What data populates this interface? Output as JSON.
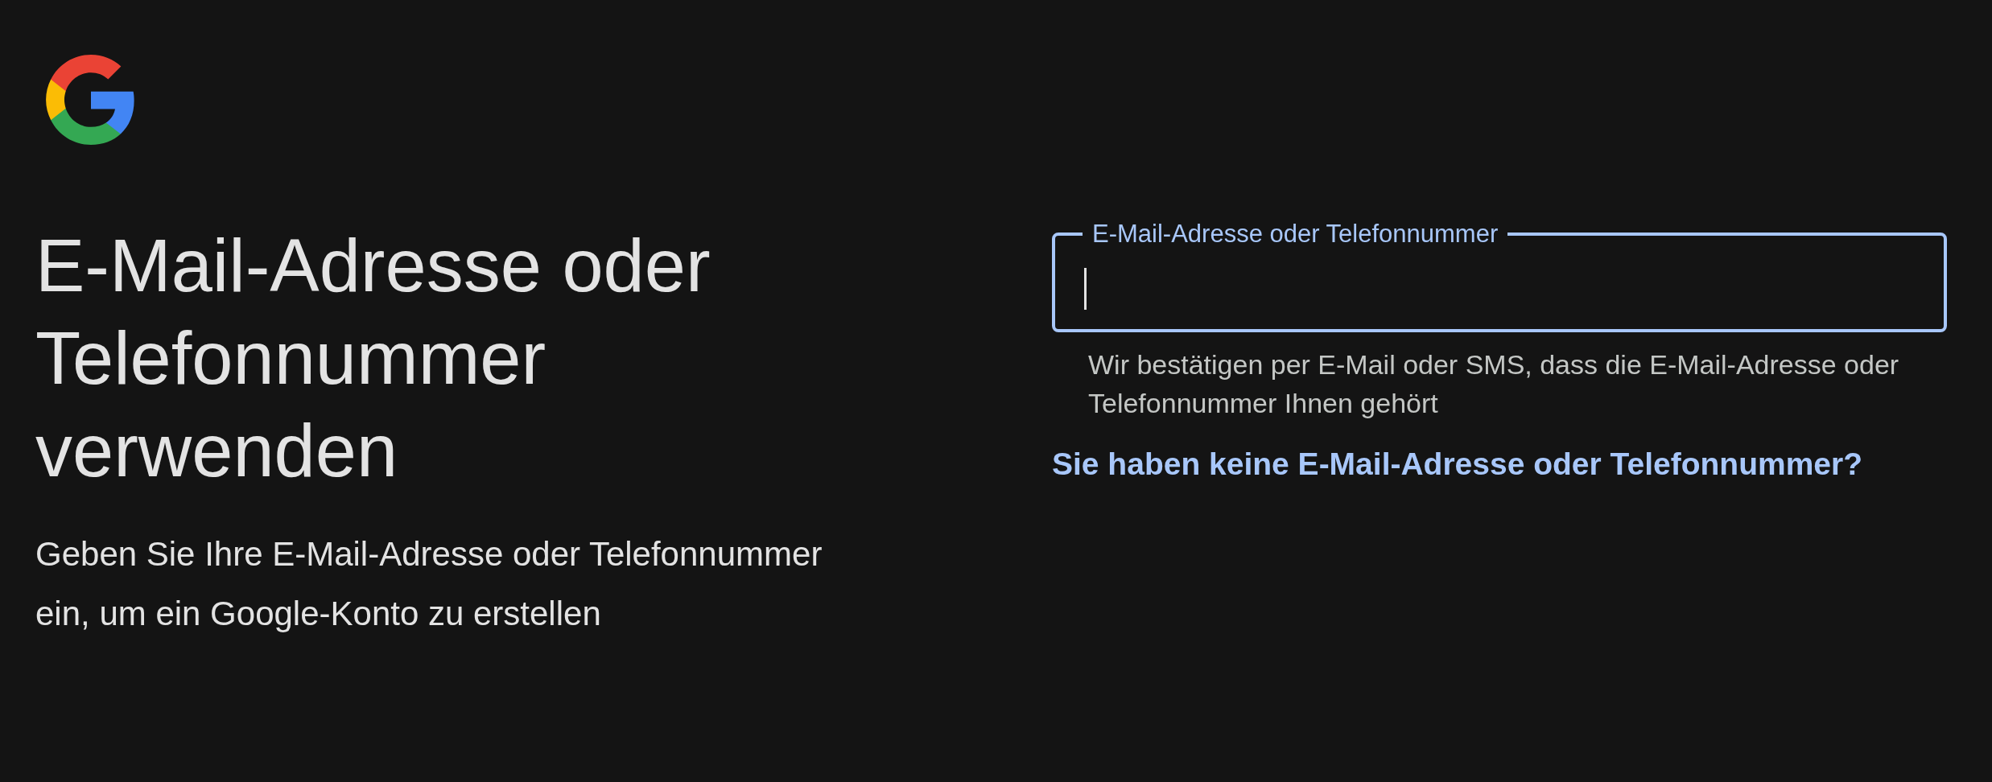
{
  "logo": {
    "kind": "google-g"
  },
  "heading": "E-Mail-Adresse oder Telefonnummer verwenden",
  "description": "Geben Sie Ihre E-Mail-Adresse oder Telefonnummer ein, um ein Google-Konto zu erstellen",
  "email_field": {
    "label": "E-Mail-Adresse oder Telefonnummer",
    "focused": true
  },
  "helper_text": "Wir bestätigen per E-Mail oder SMS, dass die E-Mail-Adresse oder Telefonnummer Ihnen gehört",
  "link": "Sie haben keine E-Mail-Adresse oder Telefonnummer?"
}
